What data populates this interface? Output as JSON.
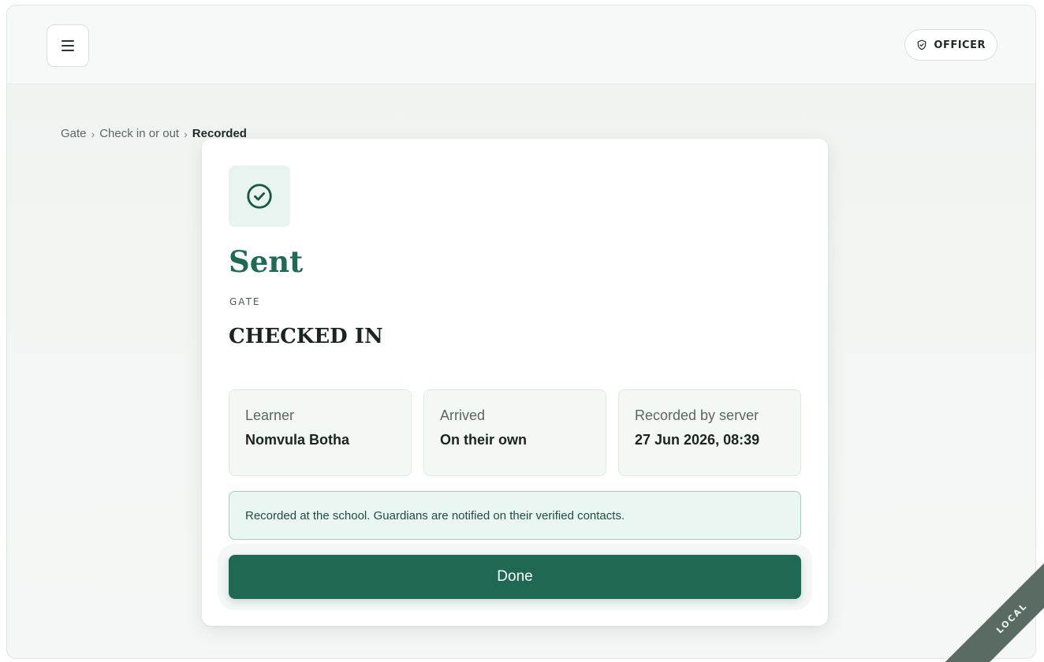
{
  "header": {
    "menu_icon": "hamburger-icon",
    "role_icon": "shield-icon",
    "role_label": "OFFICER"
  },
  "breadcrumb": {
    "items": [
      "Gate",
      "Check in or out",
      "Recorded"
    ]
  },
  "result": {
    "status_icon": "check-circle-icon",
    "title": "Sent",
    "eyebrow": "GATE",
    "status": "CHECKED IN"
  },
  "details": [
    {
      "label": "Learner",
      "value": "Nomvula Botha"
    },
    {
      "label": "Arrived",
      "value": "On their own"
    },
    {
      "label": "Recorded by server",
      "value": "27 Jun 2026, 08:39"
    }
  ],
  "notice": "Recorded at the school. Guardians are notified on their verified contacts.",
  "actions": {
    "done_label": "Done"
  },
  "environment_ribbon": "LOCAL",
  "colors": {
    "brand": "#1f6853",
    "title": "#1d6b56",
    "notice_bg": "#e9f6f1"
  }
}
